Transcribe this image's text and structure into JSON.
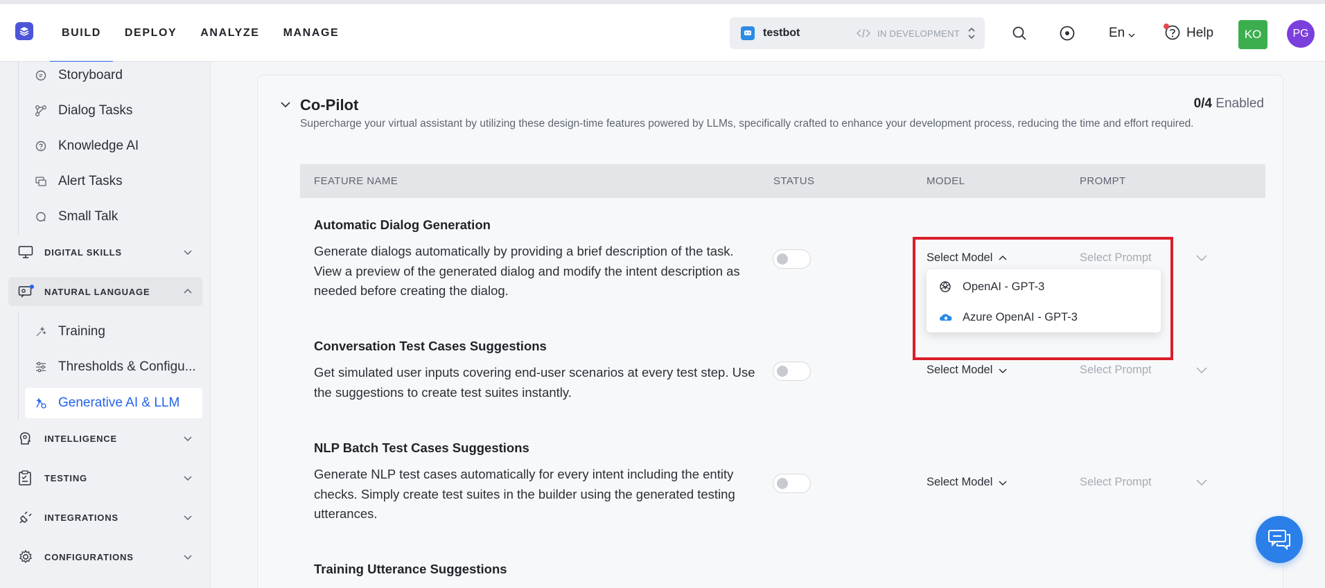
{
  "topnav": {
    "items": [
      "BUILD",
      "DEPLOY",
      "ANALYZE",
      "MANAGE"
    ],
    "active": "BUILD"
  },
  "bot": {
    "name": "testbot",
    "status": "IN DEVELOPMENT"
  },
  "header_right": {
    "language": "En",
    "help": "Help",
    "user_initials": "KO",
    "profile_initials": "PG"
  },
  "sidebar": {
    "sub_top": [
      {
        "label": "Storyboard",
        "icon": "storyboard-icon"
      },
      {
        "label": "Dialog Tasks",
        "icon": "dialog-tasks-icon"
      },
      {
        "label": "Knowledge AI",
        "icon": "knowledge-ai-icon"
      },
      {
        "label": "Alert Tasks",
        "icon": "alert-tasks-icon"
      },
      {
        "label": "Small Talk",
        "icon": "small-talk-icon"
      }
    ],
    "digital_skills": "DIGITAL SKILLS",
    "natural_language": "NATURAL LANGUAGE",
    "nl_items": [
      {
        "label": "Training"
      },
      {
        "label": "Thresholds & Configu..."
      },
      {
        "label": "Generative AI & LLM"
      }
    ],
    "intelligence": "INTELLIGENCE",
    "testing": "TESTING",
    "integrations": "INTEGRATIONS",
    "configurations": "CONFIGURATIONS"
  },
  "copilot": {
    "title": "Co-Pilot",
    "description": "Supercharge your virtual assistant by utilizing these design-time features powered by LLMs, specifically crafted to enhance your development process, reducing the time and effort required.",
    "enabled_count": "0/4",
    "enabled_label": "Enabled",
    "columns": [
      "FEATURE NAME",
      "STATUS",
      "MODEL",
      "PROMPT"
    ],
    "rows": [
      {
        "title": "Automatic Dialog Generation",
        "description": "Generate dialogs automatically by providing a brief description of the task. View a preview of the generated dialog and modify the intent description as needed before creating the dialog.",
        "model": "Select Model",
        "prompt": "Select Prompt",
        "enabled": false
      },
      {
        "title": "Conversation Test Cases Suggestions",
        "description": "Get simulated user inputs covering end-user scenarios at every test step. Use the suggestions to create test suites instantly.",
        "model": "Select Model",
        "prompt": "Select Prompt",
        "enabled": false
      },
      {
        "title": "NLP Batch Test Cases Suggestions",
        "description": "Generate NLP test cases automatically for every intent including the entity checks. Simply create test suites in the builder using the generated testing utterances.",
        "model": "Select Model",
        "prompt": "Select Prompt",
        "enabled": false
      },
      {
        "title": "Training Utterance Suggestions"
      }
    ],
    "model_options": [
      "OpenAI - GPT-3",
      "Azure OpenAI - GPT-3"
    ]
  },
  "colors": {
    "accent": "#2463eb",
    "highlight": "#d91e2a",
    "ko_avatar": "#3cae4e",
    "pg_avatar": "#7a3fdc"
  }
}
